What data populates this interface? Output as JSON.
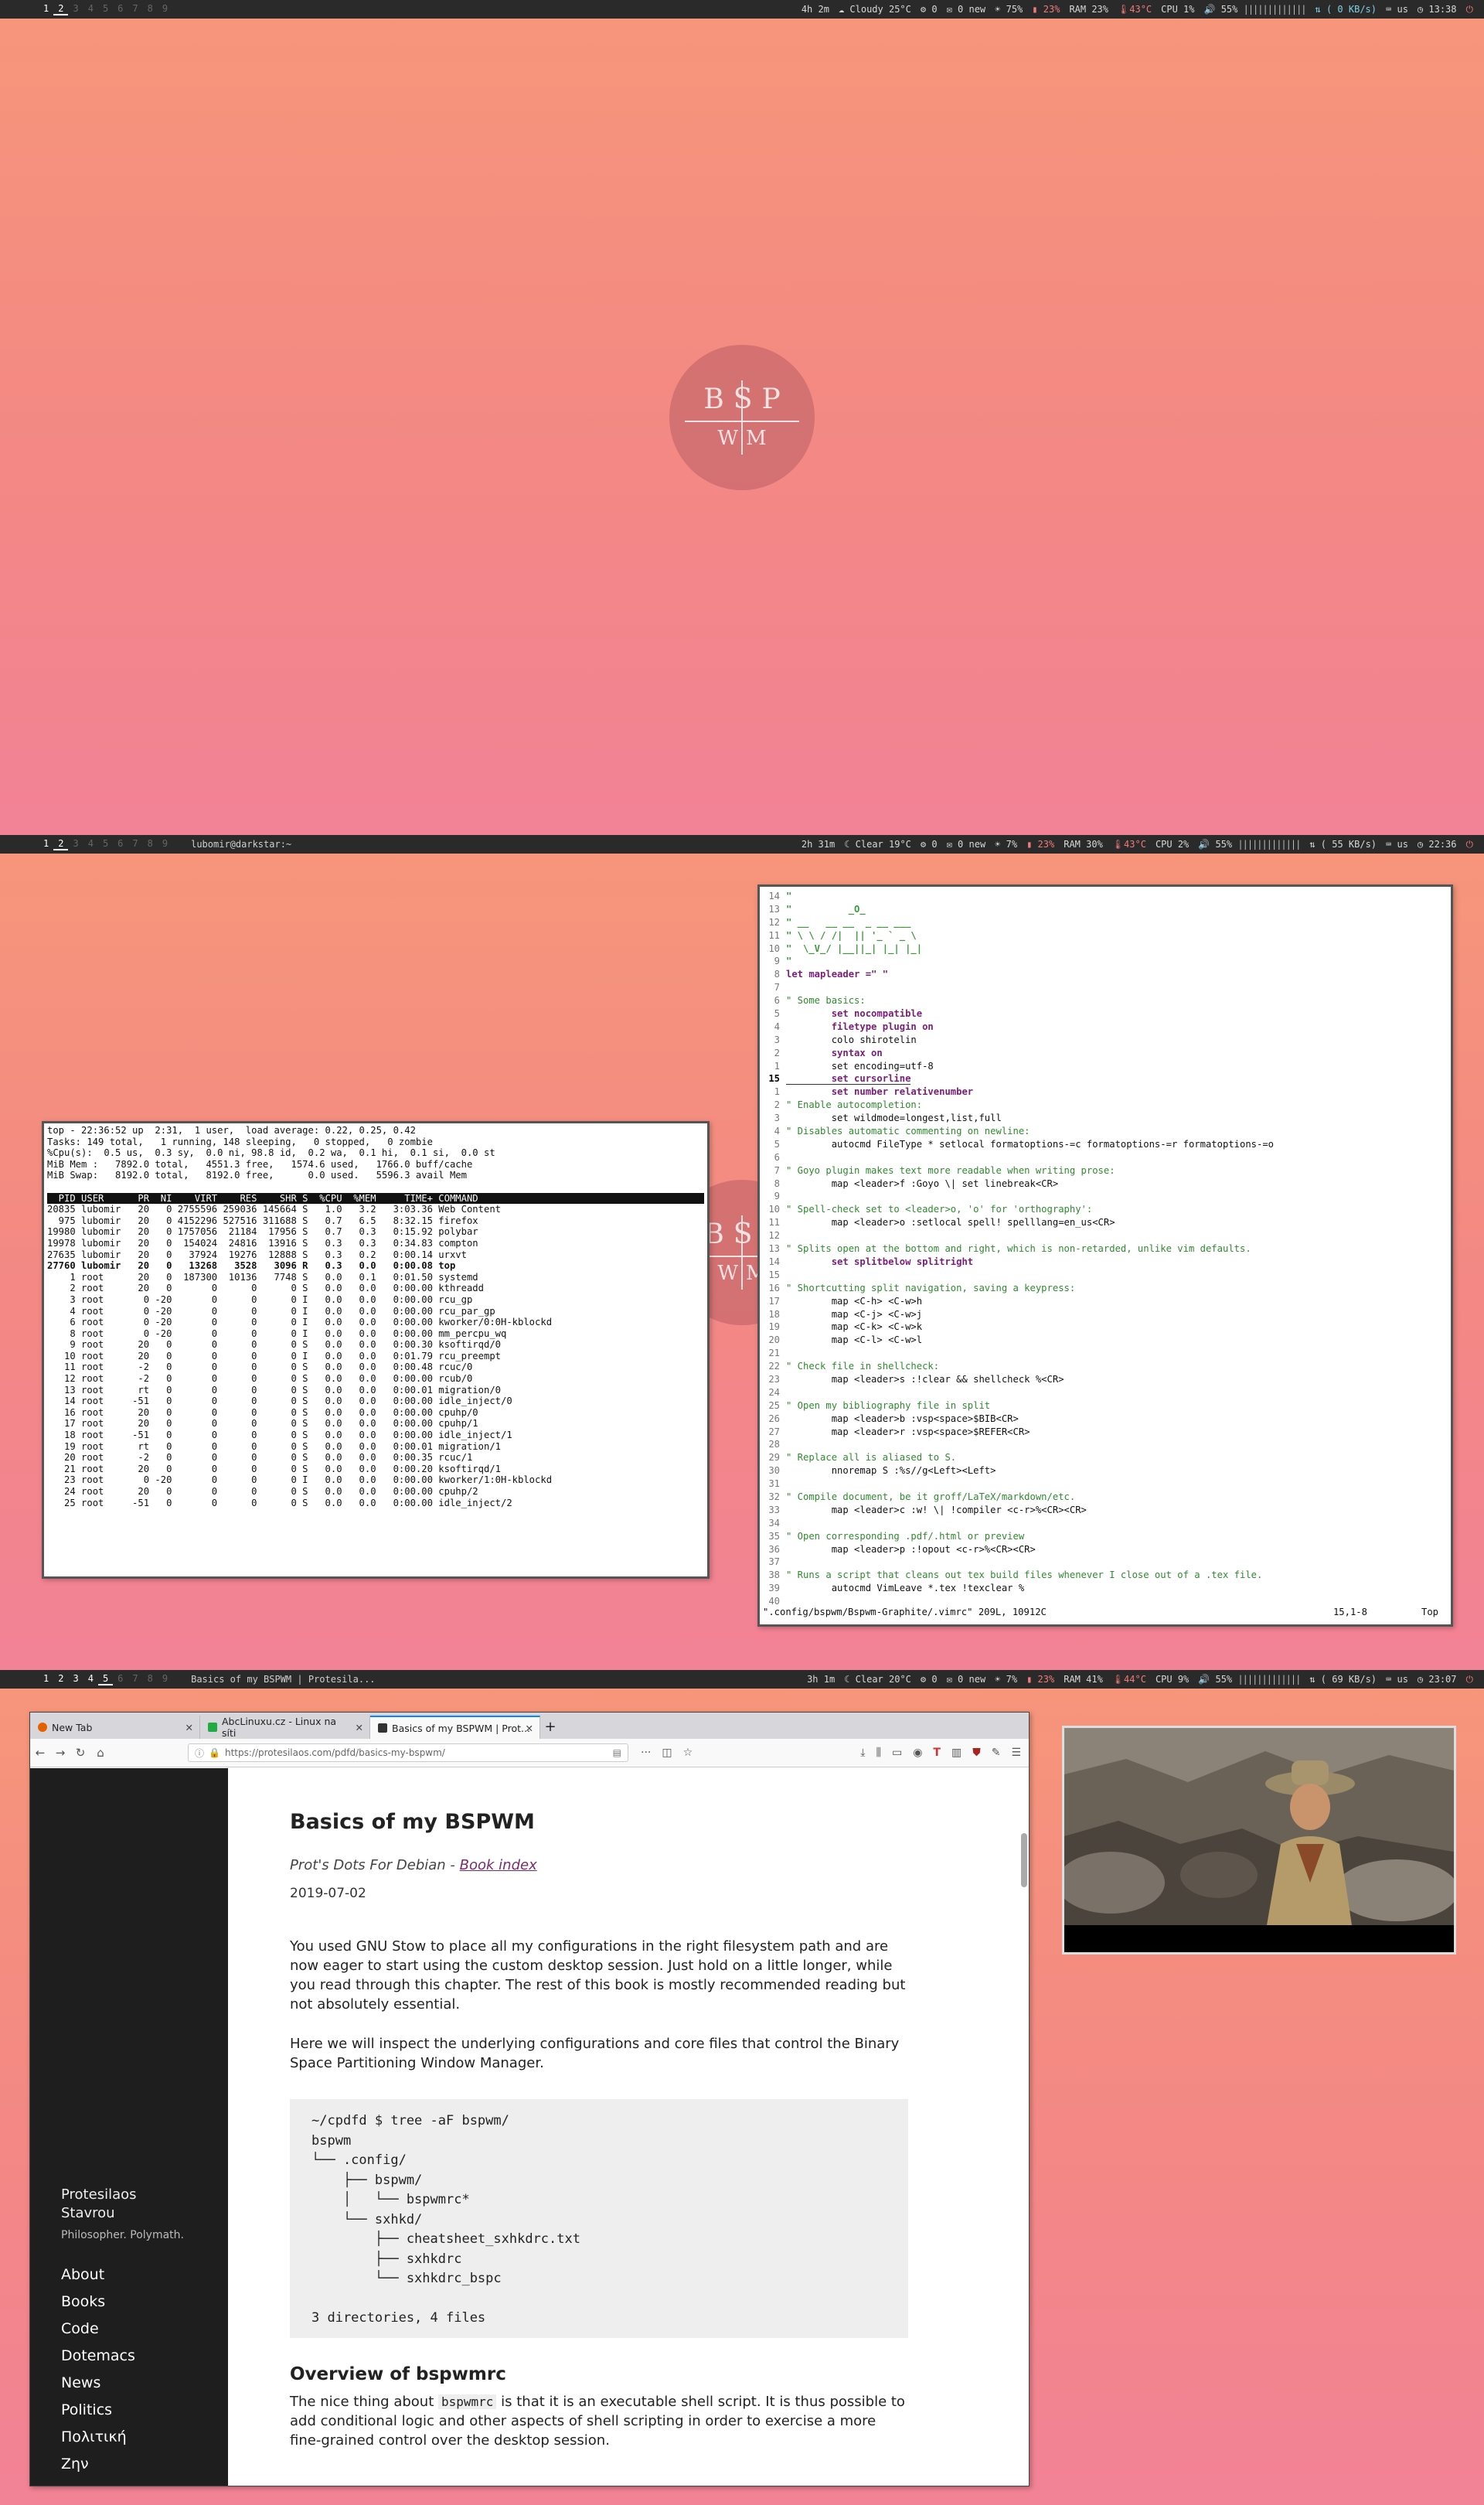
{
  "screens": [
    {
      "bar": {
        "workspaces": [
          "1",
          "2",
          "3",
          "4",
          "5",
          "6",
          "7",
          "8",
          "9"
        ],
        "active_ws": "2",
        "title": "",
        "uptime": "4h 2m",
        "weather": "Cloudy 25°C",
        "updates": "0",
        "mail": "0 new",
        "brightness": "75%",
        "battery": "23%",
        "ram": "RAM 23%",
        "temp": "43°C",
        "cpu": "CPU  1%",
        "volume": "55%",
        "net": "( 0 KB/s)",
        "kb": "us",
        "clock": "13:38"
      }
    },
    {
      "bar": {
        "workspaces": [
          "1",
          "2",
          "3",
          "4",
          "5",
          "6",
          "7",
          "8",
          "9"
        ],
        "active_ws": "2",
        "title": "lubomir@darkstar:~",
        "uptime": "2h 31m",
        "weather": "Clear 19°C",
        "updates": "0",
        "mail": "0 new",
        "brightness": "7%",
        "battery": "23%",
        "ram": "RAM 30%",
        "temp": "43°C",
        "cpu": "CPU  2%",
        "volume": "55%",
        "net": "( 55 KB/s)",
        "kb": "us",
        "clock": "22:36"
      }
    },
    {
      "bar": {
        "workspaces": [
          "1",
          "2",
          "3",
          "4",
          "5",
          "6",
          "7",
          "8",
          "9"
        ],
        "active_ws": "5",
        "title": "Basics of my BSPWM | Protesila...",
        "uptime": "3h 1m",
        "weather": "Clear 20°C",
        "updates": "0",
        "mail": "0 new",
        "brightness": "7%",
        "battery": "23%",
        "ram": "RAM 41%",
        "temp": "44°C",
        "cpu": "CPU  9%",
        "volume": "55%",
        "net": "( 69 KB/s)",
        "kb": "us",
        "clock": "23:07"
      }
    }
  ],
  "logo": {
    "top": "BSP",
    "bottom": "WM"
  },
  "top_output": {
    "header": [
      "top - 22:36:52 up  2:31,  1 user,  load average: 0.22, 0.25, 0.42",
      "Tasks: 149 total,   1 running, 148 sleeping,   0 stopped,   0 zombie",
      "%Cpu(s):  0.5 us,  0.3 sy,  0.0 ni, 98.8 id,  0.2 wa,  0.1 hi,  0.1 si,  0.0 st",
      "MiB Mem :   7892.0 total,   4551.3 free,   1574.6 used,   1766.0 buff/cache",
      "MiB Swap:   8192.0 total,   8192.0 free,      0.0 used.   5596.3 avail Mem"
    ],
    "columns": "  PID USER      PR  NI    VIRT    RES    SHR S  %CPU  %MEM     TIME+ COMMAND",
    "rows": [
      "20835 lubomir   20   0 2755596 259036 145664 S   1.0   3.2   3:03.36 Web Content",
      "  975 lubomir   20   0 4152296 527516 311688 S   0.7   6.5   8:32.15 firefox",
      "19980 lubomir   20   0 1757056  21184  17956 S   0.7   0.3   0:15.92 polybar",
      "19978 lubomir   20   0  154024  24816  13916 S   0.3   0.3   0:34.83 compton",
      "27635 lubomir   20   0   37924  19276  12888 S   0.3   0.2   0:00.14 urxvt",
      "27760 lubomir   20   0   13268   3528   3096 R   0.3   0.0   0:00.08 top",
      "    1 root      20   0  187300  10136   7748 S   0.0   0.1   0:01.50 systemd",
      "    2 root      20   0       0      0      0 S   0.0   0.0   0:00.00 kthreadd",
      "    3 root       0 -20       0      0      0 I   0.0   0.0   0:00.00 rcu_gp",
      "    4 root       0 -20       0      0      0 I   0.0   0.0   0:00.00 rcu_par_gp",
      "    6 root       0 -20       0      0      0 I   0.0   0.0   0:00.00 kworker/0:0H-kblockd",
      "    8 root       0 -20       0      0      0 I   0.0   0.0   0:00.00 mm_percpu_wq",
      "    9 root      20   0       0      0      0 S   0.0   0.0   0:00.30 ksoftirqd/0",
      "   10 root      20   0       0      0      0 I   0.0   0.0   0:01.79 rcu_preempt",
      "   11 root      -2   0       0      0      0 S   0.0   0.0   0:00.48 rcuc/0",
      "   12 root      -2   0       0      0      0 S   0.0   0.0   0:00.00 rcub/0",
      "   13 root      rt   0       0      0      0 S   0.0   0.0   0:00.01 migration/0",
      "   14 root     -51   0       0      0      0 S   0.0   0.0   0:00.00 idle_inject/0",
      "   16 root      20   0       0      0      0 S   0.0   0.0   0:00.00 cpuhp/0",
      "   17 root      20   0       0      0      0 S   0.0   0.0   0:00.00 cpuhp/1",
      "   18 root     -51   0       0      0      0 S   0.0   0.0   0:00.00 idle_inject/1",
      "   19 root      rt   0       0      0      0 S   0.0   0.0   0:00.01 migration/1",
      "   20 root      -2   0       0      0      0 S   0.0   0.0   0:00.35 rcuc/1",
      "   21 root      20   0       0      0      0 S   0.0   0.0   0:00.20 ksoftirqd/1",
      "   23 root       0 -20       0      0      0 I   0.0   0.0   0:00.00 kworker/1:0H-kblockd",
      "   24 root      20   0       0      0      0 S   0.0   0.0   0:00.00 cpuhp/2",
      "   25 root     -51   0       0      0      0 S   0.0   0.0   0:00.00 idle_inject/2"
    ]
  },
  "vim": {
    "art_lines": [
      {
        "n": "14",
        "t": "\""
      },
      {
        "n": "13",
        "t": "\"          _O_"
      },
      {
        "n": "12",
        "t": "\" __   __ __  _ __ ___"
      },
      {
        "n": "11",
        "t": "\" \\ \\ / /|  || '_ ` _ \\"
      },
      {
        "n": "10",
        "t": "\"  \\_V_/ |__||_| |_| |_|"
      },
      {
        "n": "9",
        "t": "\""
      }
    ],
    "lines": [
      {
        "n": "8",
        "t": "let mapleader =\" \"",
        "c": "kw"
      },
      {
        "n": "7",
        "t": ""
      },
      {
        "n": "6",
        "t": "\" Some basics:",
        "c": "cl"
      },
      {
        "n": "5",
        "t": "        set nocompatible",
        "c": "kw"
      },
      {
        "n": "4",
        "t": "        filetype plugin on",
        "c": "kw"
      },
      {
        "n": "3",
        "t": "        colo shirotelin",
        "c": ""
      },
      {
        "n": "2",
        "t": "        syntax on",
        "c": "kw"
      },
      {
        "n": "1",
        "t": "        set encoding=utf-8",
        "c": ""
      },
      {
        "n": "15",
        "t": "        set cursorline",
        "c": "kw cur"
      },
      {
        "n": "1",
        "t": "        set number relativenumber",
        "c": "kw"
      },
      {
        "n": "2",
        "t": "\" Enable autocompletion:",
        "c": "cl"
      },
      {
        "n": "3",
        "t": "        set wildmode=longest,list,full",
        "c": ""
      },
      {
        "n": "4",
        "t": "\" Disables automatic commenting on newline:",
        "c": "cl"
      },
      {
        "n": "5",
        "t": "        autocmd FileType * setlocal formatoptions-=c formatoptions-=r formatoptions-=o",
        "c": ""
      },
      {
        "n": "6",
        "t": ""
      },
      {
        "n": "7",
        "t": "\" Goyo plugin makes text more readable when writing prose:",
        "c": "cl"
      },
      {
        "n": "8",
        "t": "        map <leader>f :Goyo \\| set linebreak<CR>",
        "c": ""
      },
      {
        "n": "9",
        "t": ""
      },
      {
        "n": "10",
        "t": "\" Spell-check set to <leader>o, 'o' for 'orthography':",
        "c": "cl"
      },
      {
        "n": "11",
        "t": "        map <leader>o :setlocal spell! spelllang=en_us<CR>",
        "c": ""
      },
      {
        "n": "12",
        "t": ""
      },
      {
        "n": "13",
        "t": "\" Splits open at the bottom and right, which is non-retarded, unlike vim defaults.",
        "c": "cl"
      },
      {
        "n": "14",
        "t": "        set splitbelow splitright",
        "c": "kw"
      },
      {
        "n": "15",
        "t": ""
      },
      {
        "n": "16",
        "t": "\" Shortcutting split navigation, saving a keypress:",
        "c": "cl"
      },
      {
        "n": "17",
        "t": "        map <C-h> <C-w>h",
        "c": ""
      },
      {
        "n": "18",
        "t": "        map <C-j> <C-w>j",
        "c": ""
      },
      {
        "n": "19",
        "t": "        map <C-k> <C-w>k",
        "c": ""
      },
      {
        "n": "20",
        "t": "        map <C-l> <C-w>l",
        "c": ""
      },
      {
        "n": "21",
        "t": ""
      },
      {
        "n": "22",
        "t": "\" Check file in shellcheck:",
        "c": "cl"
      },
      {
        "n": "23",
        "t": "        map <leader>s :!clear && shellcheck %<CR>",
        "c": ""
      },
      {
        "n": "24",
        "t": ""
      },
      {
        "n": "25",
        "t": "\" Open my bibliography file in split",
        "c": "cl"
      },
      {
        "n": "26",
        "t": "        map <leader>b :vsp<space>$BIB<CR>",
        "c": ""
      },
      {
        "n": "27",
        "t": "        map <leader>r :vsp<space>$REFER<CR>",
        "c": ""
      },
      {
        "n": "28",
        "t": ""
      },
      {
        "n": "29",
        "t": "\" Replace all is aliased to S.",
        "c": "cl"
      },
      {
        "n": "30",
        "t": "        nnoremap S :%s//g<Left><Left>",
        "c": ""
      },
      {
        "n": "31",
        "t": ""
      },
      {
        "n": "32",
        "t": "\" Compile document, be it groff/LaTeX/markdown/etc.",
        "c": "cl"
      },
      {
        "n": "33",
        "t": "        map <leader>c :w! \\| !compiler <c-r>%<CR><CR>",
        "c": ""
      },
      {
        "n": "34",
        "t": ""
      },
      {
        "n": "35",
        "t": "\" Open corresponding .pdf/.html or preview",
        "c": "cl"
      },
      {
        "n": "36",
        "t": "        map <leader>p :!opout <c-r>%<CR><CR>",
        "c": ""
      },
      {
        "n": "37",
        "t": ""
      },
      {
        "n": "38",
        "t": "\" Runs a script that cleans out tex build files whenever I close out of a .tex file.",
        "c": "cl"
      },
      {
        "n": "39",
        "t": "        autocmd VimLeave *.tex !texclear %",
        "c": ""
      },
      {
        "n": "40",
        "t": ""
      }
    ],
    "status_left": "\".config/bspwm/Bspwm-Graphite/.vimrc\" 209L, 10912C",
    "status_pos": "15,1-8",
    "status_top": "Top"
  },
  "browser": {
    "tabs": [
      {
        "label": "New Tab"
      },
      {
        "label": "AbcLinuxu.cz - Linux na síti"
      },
      {
        "label": "Basics of my BSPWM | Prot..."
      }
    ],
    "url": "https://protesilaos.com/pdfd/basics-my-bspwm/",
    "sidebar": {
      "name_line1": "Protesilaos",
      "name_line2": "Stavrou",
      "tagline": "Philosopher. Polymath.",
      "links": [
        "About",
        "Books",
        "Code",
        "Dotemacs",
        "News",
        "Politics",
        "Πολιτική",
        "Ζην"
      ]
    },
    "article": {
      "title": "Basics of my BSPWM",
      "subtitle_prefix": "Prot's Dots For Debian - ",
      "subtitle_link": "Book index",
      "date": "2019-07-02",
      "p1": "You used GNU Stow to place all my configurations in the right filesystem path and are now eager to start using the custom desktop session. Just hold on a little longer, while you read through this chapter. The rest of this book is mostly recommended reading but not absolutely essential.",
      "p2": "Here we will inspect the underlying configurations and core files that control the Binary Space Partitioning Window Manager.",
      "code": "~/cpdfd $ tree -aF bspwm/\nbspwm\n└── .config/\n    ├── bspwm/\n    │   └── bspwmrc*\n    └── sxhkd/\n        ├── cheatsheet_sxhkdrc.txt\n        ├── sxhkdrc\n        └── sxhkdrc_bspc\n\n3 directories, 4 files",
      "h2": "Overview of bspwmrc",
      "p3_a": "The nice thing about ",
      "p3_code": "bspwmrc",
      "p3_b": " is that it is an executable shell script. It is thus possible to add conditional logic and other aspects of shell scripting in order to exercise a more fine-grained control over the desktop session."
    }
  }
}
